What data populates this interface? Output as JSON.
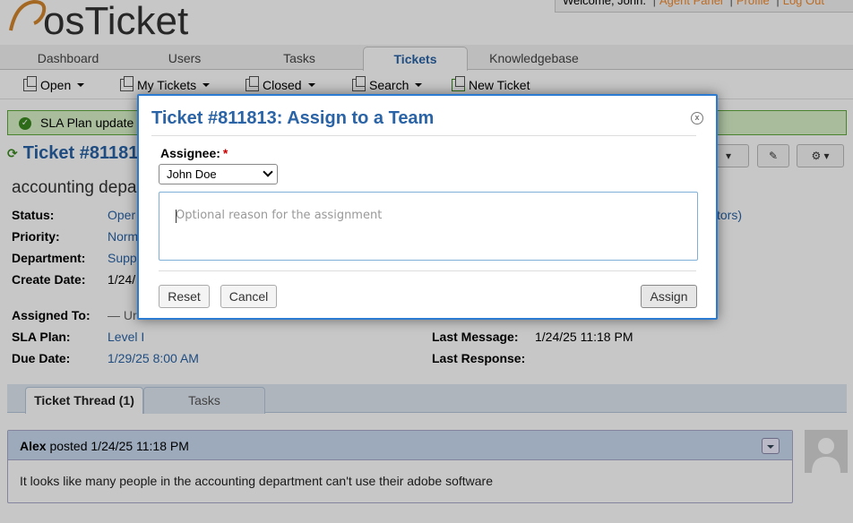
{
  "header": {
    "brand": "osTicket",
    "welcome_text": "Welcome, John.",
    "links": [
      "Agent Panel",
      "Profile",
      "Log Out"
    ]
  },
  "nav": {
    "tabs": [
      {
        "label": "Dashboard",
        "active": false
      },
      {
        "label": "Users",
        "active": false
      },
      {
        "label": "Tasks",
        "active": false
      },
      {
        "label": "Tickets",
        "active": true
      },
      {
        "label": "Knowledgebase",
        "active": false
      }
    ]
  },
  "subnav": {
    "items": [
      "Open",
      "My Tickets",
      "Closed",
      "Search",
      "New Ticket"
    ]
  },
  "alert": {
    "text": "SLA Plan update"
  },
  "ticket": {
    "title": "Ticket #81181",
    "subject": "accounting depa",
    "fields": {
      "status_label": "Status:",
      "status_value": "Oper",
      "priority_label": "Priority:",
      "priority_value": "Norm",
      "department_label": "Department:",
      "department_value": "Supp",
      "create_date_label": "Create Date:",
      "create_date_value": "1/24/",
      "collaborators_fragment": "tors)",
      "assigned_to_label": "Assigned To:",
      "assigned_to_value": "— Ur",
      "sla_plan_label": "SLA Plan:",
      "sla_plan_value": "Level I",
      "due_date_label": "Due Date:",
      "due_date_value": "1/29/25 8:00 AM",
      "last_message_label": "Last Message:",
      "last_message_value": "1/24/25 11:18 PM",
      "last_response_label": "Last Response:",
      "last_response_value": ""
    }
  },
  "thread_tabs": [
    {
      "label": "Ticket Thread (1)",
      "active": true
    },
    {
      "label": "Tasks",
      "active": false
    }
  ],
  "thread": {
    "author": "Alex",
    "posted_text": "posted 1/24/25 11:18 PM",
    "body": "It looks like many people in the accounting department can't use their adobe software"
  },
  "modal": {
    "title": "Ticket #811813: Assign to a Team",
    "assignee_label": "Assignee:",
    "required_mark": "*",
    "assignee_selected": "John Doe",
    "reason_placeholder": "Optional reason for the assignment",
    "reset_label": "Reset",
    "cancel_label": "Cancel",
    "assign_label": "Assign",
    "close_glyph": "x"
  },
  "colors": {
    "accent_blue": "#2a63a6",
    "modal_border": "#2a7bd1",
    "success_bg": "#d9f3c9",
    "brand_orange": "#f28a2c"
  }
}
